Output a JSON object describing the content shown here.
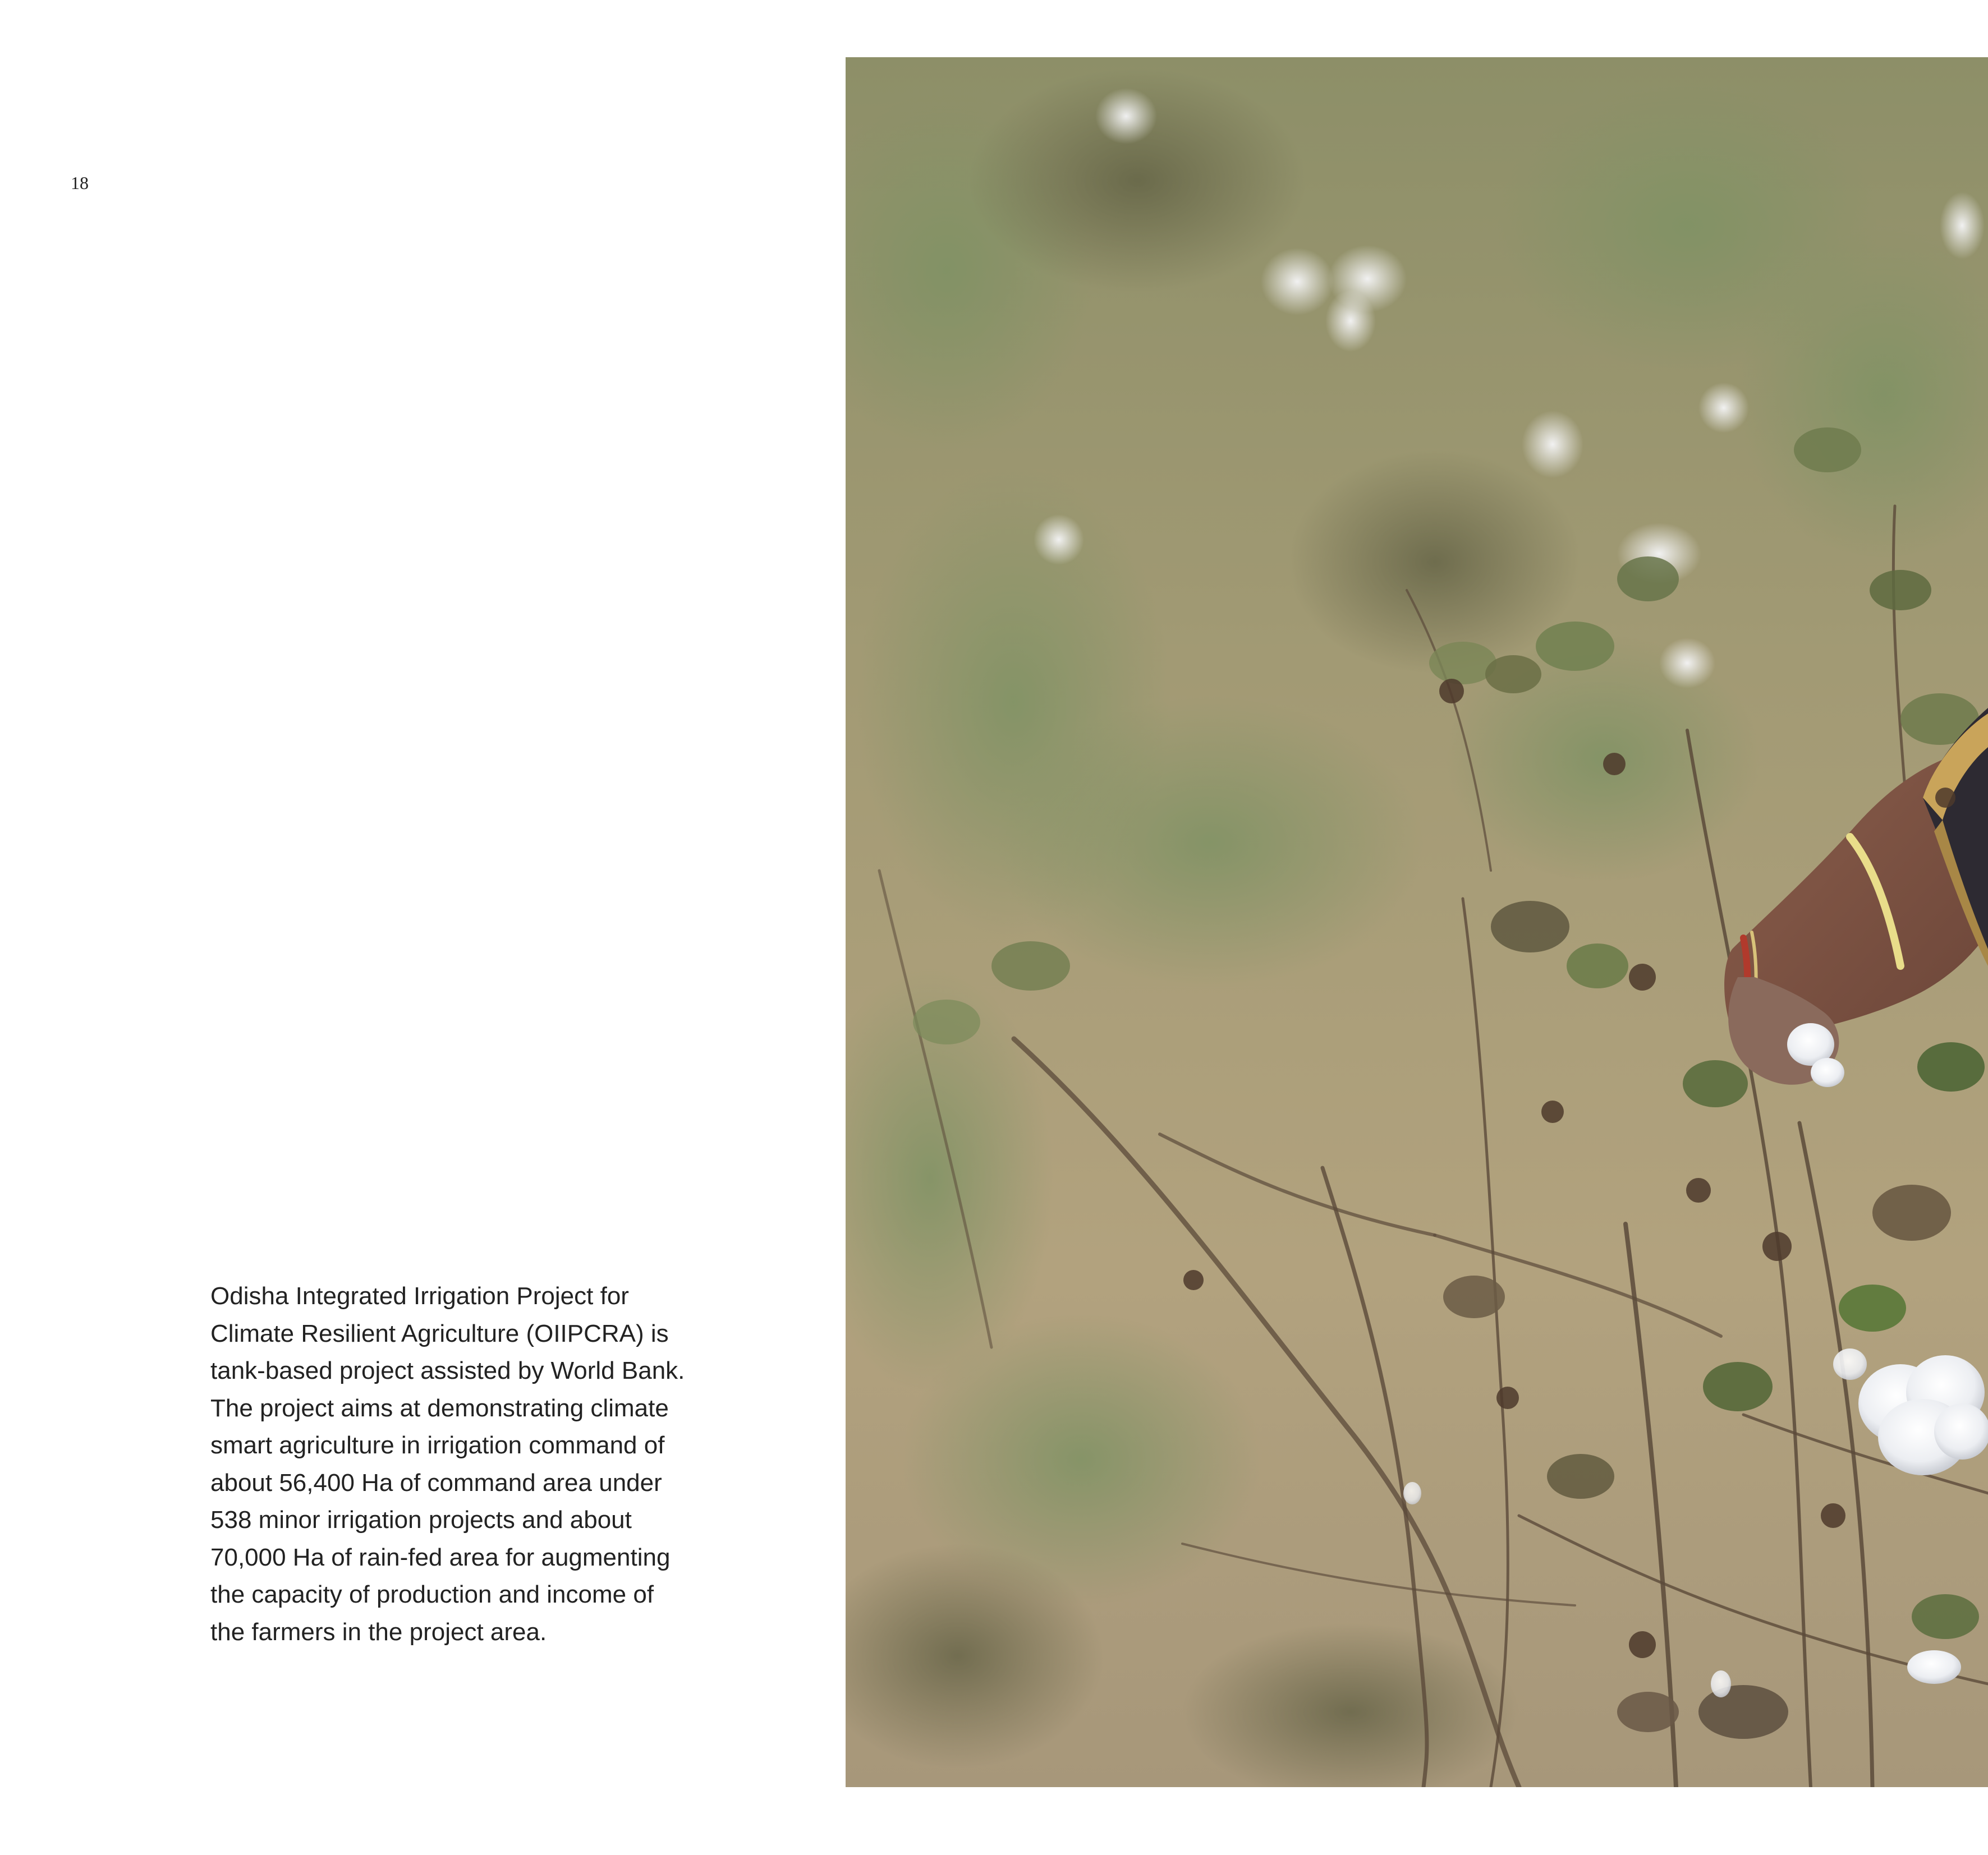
{
  "page": {
    "number": "18"
  },
  "caption": {
    "lines": [
      "Odisha Integrated Irrigation Project for",
      "Climate Resilient Agriculture (OIIPCRA) is",
      "tank-based project assisted by World Bank.",
      "The project aims at demonstrating climate",
      "smart agriculture in irrigation command of",
      "about 56,400 Ha of command area under",
      "538 minor irrigation projects and about",
      "70,000 Ha of rain-fed area for augmenting",
      "the capacity of production and income of",
      "the farmers in the project area."
    ]
  },
  "photo": {
    "colors": {
      "background": "#a69a79",
      "foliage": "#6f7a4c",
      "stems": "#5b4a3a",
      "cotton": "#f4f4f6",
      "skin": "#7e5646",
      "sleeve": "#2d2a32",
      "border_gold": "#c9a45a"
    }
  }
}
